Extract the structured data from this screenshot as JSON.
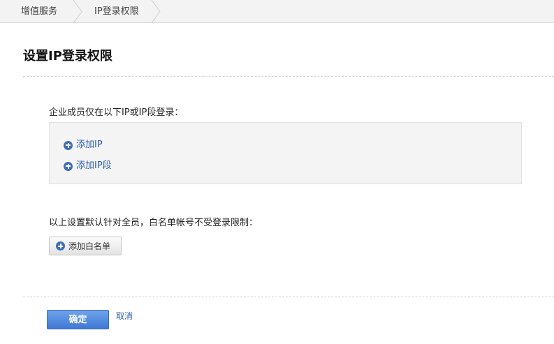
{
  "breadcrumb": {
    "items": [
      {
        "label": "增值服务"
      },
      {
        "label": "IP登录权限"
      }
    ]
  },
  "page_title": "设置IP登录权限",
  "ip_section": {
    "label": "企业成员仅在以下IP或IP段登录：",
    "add_ip_label": "添加IP",
    "add_ip_range_label": "添加IP段"
  },
  "whitelist_section": {
    "label": "以上设置默认针对全员，白名单帐号不受登录限制：",
    "add_whitelist_label": "添加白名单"
  },
  "footer": {
    "confirm_label": "确定",
    "cancel_label": "取消"
  },
  "colors": {
    "link": "#2a5ea8",
    "plus_icon": "#3f6db8",
    "primary_button": "#4a82dc"
  }
}
